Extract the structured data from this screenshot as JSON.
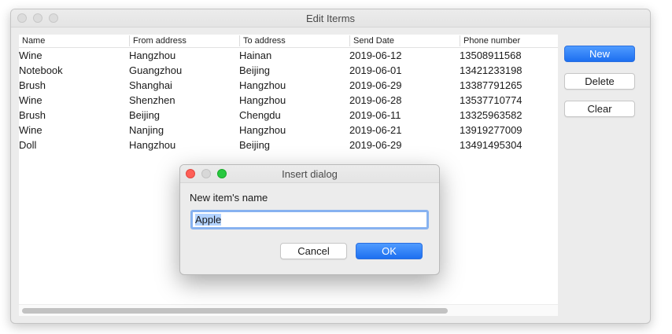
{
  "main_window": {
    "title": "Edit Iterms",
    "table": {
      "columns": [
        "Name",
        "From address",
        "To address",
        "Send Date",
        "Phone number"
      ],
      "rows": [
        [
          "Wine",
          "Hangzhou",
          "Hainan",
          "2019-06-12",
          "13508911568"
        ],
        [
          "Notebook",
          "Guangzhou",
          "Beijing",
          "2019-06-01",
          "13421233198"
        ],
        [
          "Brush",
          "Shanghai",
          "Hangzhou",
          "2019-06-29",
          "13387791265"
        ],
        [
          "Wine",
          "Shenzhen",
          "Hangzhou",
          "2019-06-28",
          "13537710774"
        ],
        [
          "Brush",
          "Beijing",
          "Chengdu",
          "2019-06-11",
          "13325963582"
        ],
        [
          "Wine",
          "Nanjing",
          "Hangzhou",
          "2019-06-21",
          "13919277009"
        ],
        [
          "Doll",
          "Hangzhou",
          "Beijing",
          "2019-06-29",
          "13491495304"
        ]
      ]
    },
    "buttons": {
      "new_label": "New",
      "delete_label": "Delete",
      "clear_label": "Clear"
    }
  },
  "dialog": {
    "title": "Insert dialog",
    "prompt": "New item's name",
    "input_value": "Apple",
    "cancel_label": "Cancel",
    "ok_label": "OK"
  },
  "colors": {
    "accent": "#1d6ff0",
    "close": "#fe5f57",
    "maximize": "#28c840",
    "selection": "#b2d2ff"
  }
}
